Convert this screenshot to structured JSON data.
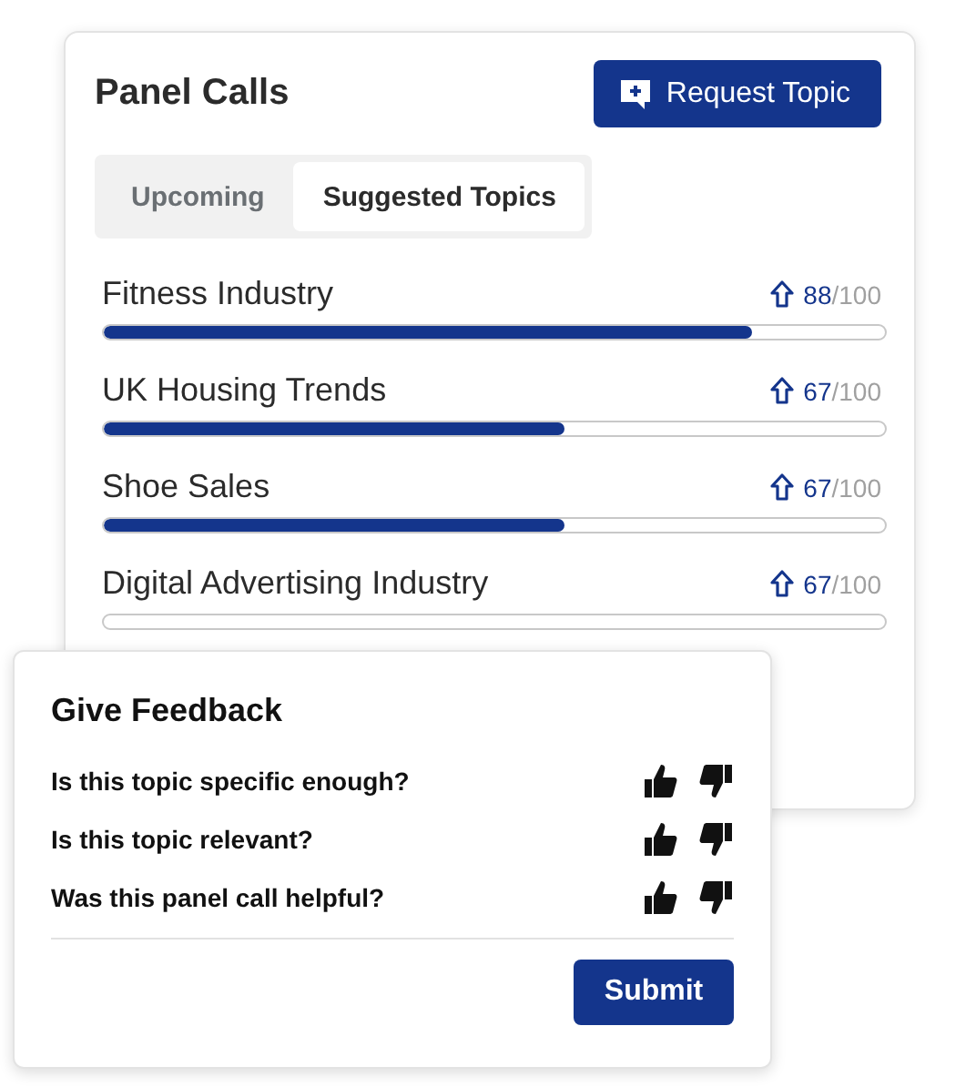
{
  "panel": {
    "title": "Panel Calls",
    "request_button": "Request Topic",
    "tabs": [
      {
        "label": "Upcoming",
        "selected": false
      },
      {
        "label": "Suggested Topics",
        "selected": true
      }
    ],
    "topics": [
      {
        "name": "Fitness Industry",
        "score": "88",
        "max": "/100",
        "level": 0.83
      },
      {
        "name": "UK Housing Trends",
        "score": "67",
        "max": "/100",
        "level": 0.59
      },
      {
        "name": "Shoe Sales",
        "score": "67",
        "max": "/100",
        "level": 0.59
      },
      {
        "name": "Digital Advertising Industry",
        "score": "67",
        "max": "/100"
      }
    ]
  },
  "feedback": {
    "title": "Give Feedback",
    "questions": [
      "Is this topic specific enough?",
      "Is this topic relevant?",
      "Was this panel call helpful?"
    ],
    "submit": "Submit"
  }
}
